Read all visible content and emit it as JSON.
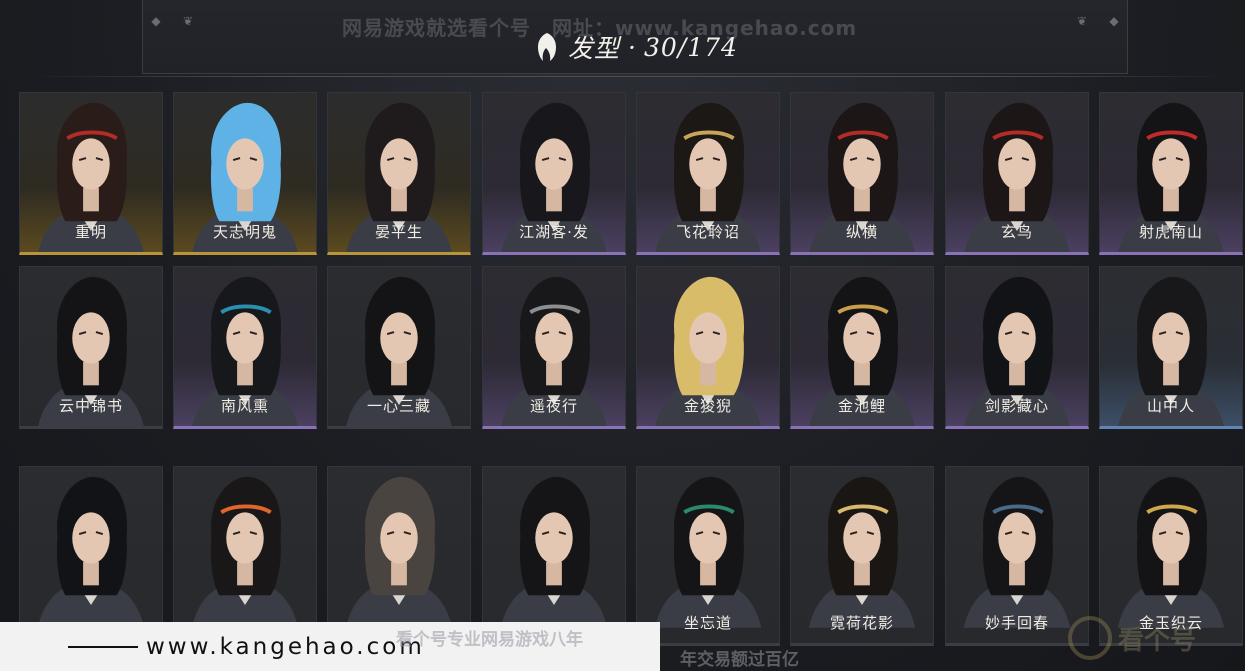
{
  "header": {
    "watermark": "网易游戏就选看个号　网址：www.kangehao.com",
    "title": "发型",
    "separator": "·",
    "count": "30/174"
  },
  "colors": {
    "gold": "#b8943a",
    "purple": "#8a72b6",
    "blue": "#5f86b0",
    "background": "#1d1f24"
  },
  "hairstyles": [
    {
      "name": "重明",
      "rarity": "gold",
      "hair": "#2a1c18",
      "accent": "#b32c28"
    },
    {
      "name": "天志明鬼",
      "rarity": "gold",
      "hair": "#5fb2e6",
      "accent": "#5fb2e6"
    },
    {
      "name": "晏平生",
      "rarity": "gold",
      "hair": "#1f1a1c",
      "accent": "#1f1a1c"
    },
    {
      "name": "江湖客·发",
      "rarity": "purple",
      "hair": "#18181c",
      "accent": "#18181c"
    },
    {
      "name": "飞花聆诏",
      "rarity": "purple",
      "hair": "#1c1816",
      "accent": "#c8a45a"
    },
    {
      "name": "纵横",
      "rarity": "purple",
      "hair": "#1c1616",
      "accent": "#b32c28"
    },
    {
      "name": "玄鸟",
      "rarity": "purple",
      "hair": "#1c1616",
      "accent": "#b32c28"
    },
    {
      "name": "射虎南山",
      "rarity": "purple",
      "hair": "#141416",
      "accent": "#c22a2a"
    },
    {
      "name": "云中锦书",
      "rarity": "plain",
      "hair": "#141416",
      "accent": "#141416"
    },
    {
      "name": "南风熏",
      "rarity": "purple",
      "hair": "#16181c",
      "accent": "#2b8fb0"
    },
    {
      "name": "一心三藏",
      "rarity": "plain",
      "hair": "#141416",
      "accent": "#141416"
    },
    {
      "name": "遥夜行",
      "rarity": "purple",
      "hair": "#18181a",
      "accent": "#8c8e90"
    },
    {
      "name": "金狻猊",
      "rarity": "purple",
      "hair": "#d8bc6a",
      "accent": "#d8bc6a"
    },
    {
      "name": "金池鲤",
      "rarity": "purple",
      "hair": "#141416",
      "accent": "#c8a04a"
    },
    {
      "name": "剑影藏心",
      "rarity": "purple",
      "hair": "#121316",
      "accent": "#121316"
    },
    {
      "name": "山中人",
      "rarity": "blue",
      "hair": "#18181a",
      "accent": "#18181a"
    },
    {
      "name": "",
      "rarity": "plain",
      "hair": "#121316",
      "accent": "#121316"
    },
    {
      "name": "",
      "rarity": "plain",
      "hair": "#1a1718",
      "accent": "#e0662a"
    },
    {
      "name": "",
      "rarity": "plain",
      "hair": "#4a4440",
      "accent": "#4a4440"
    },
    {
      "name": "",
      "rarity": "plain",
      "hair": "#151518",
      "accent": "#151518"
    },
    {
      "name": "坐忘道",
      "rarity": "plain",
      "hair": "#151518",
      "accent": "#2a8a6a"
    },
    {
      "name": "霓荷花影",
      "rarity": "plain",
      "hair": "#1a1614",
      "accent": "#d8b86a"
    },
    {
      "name": "妙手回春",
      "rarity": "plain",
      "hair": "#151518",
      "accent": "#4a6a8a"
    },
    {
      "name": "金玉织云",
      "rarity": "plain",
      "hair": "#141416",
      "accent": "#d0a84a"
    }
  ],
  "watermark_bottom": {
    "url": "www.kangehao.com",
    "slogan_line1": "看个号专业网易游戏八年",
    "slogan_line2": "年交易额过百亿",
    "logo_text": "看个号"
  }
}
